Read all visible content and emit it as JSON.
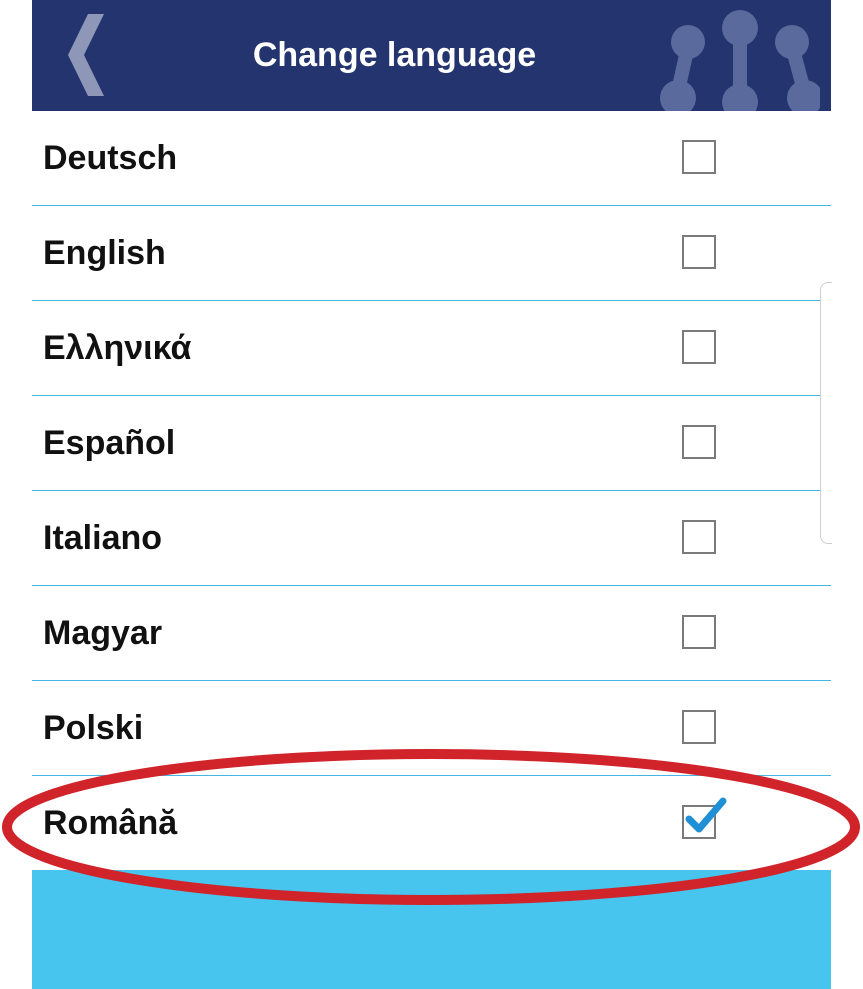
{
  "header": {
    "title": "Change language",
    "back_icon": "chevron-left-icon",
    "logo_icon": "molecule-logo-icon",
    "background_color": "#23346e"
  },
  "languages": [
    {
      "label": "Deutsch",
      "checked": false
    },
    {
      "label": "English",
      "checked": false
    },
    {
      "label": "Ελληνικά",
      "checked": false
    },
    {
      "label": "Español",
      "checked": false
    },
    {
      "label": "Italiano",
      "checked": false
    },
    {
      "label": "Magyar",
      "checked": false
    },
    {
      "label": "Polski",
      "checked": false
    },
    {
      "label": "Română",
      "checked": true
    }
  ],
  "colors": {
    "divider": "#45b5e3",
    "checkmark": "#1f8fd6",
    "bottom_bar": "#47c5ee",
    "annotation": "#d0232a"
  }
}
